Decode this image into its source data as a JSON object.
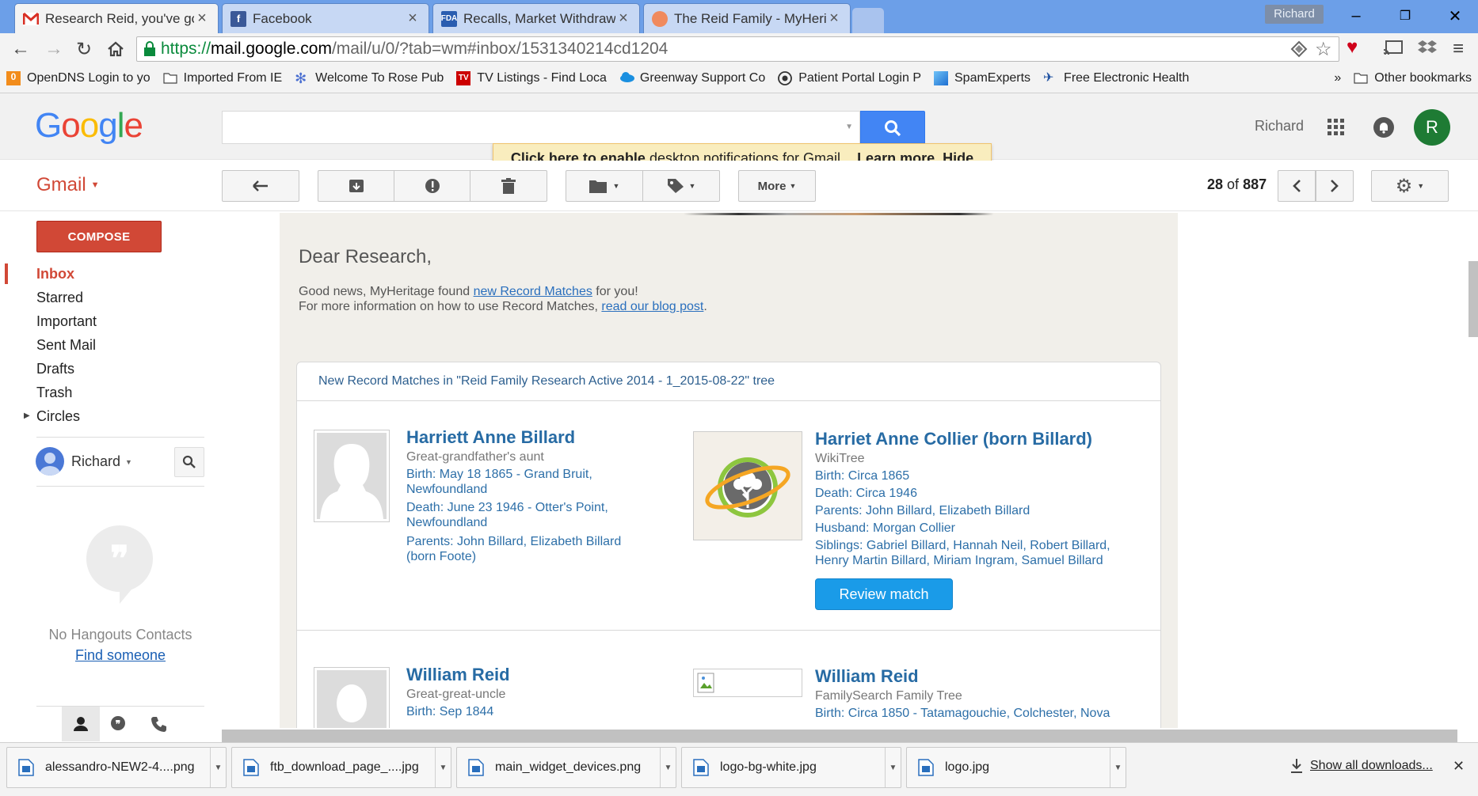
{
  "browser": {
    "tabs": [
      {
        "title": "Research Reid, you've got",
        "icon": "gmail-icon",
        "active": true
      },
      {
        "title": "Facebook",
        "icon": "facebook-icon",
        "active": false
      },
      {
        "title": "Recalls, Market Withdraw",
        "icon": "fda-icon",
        "active": false
      },
      {
        "title": "The Reid Family - MyHerit",
        "icon": "myheritage-icon",
        "active": false
      }
    ],
    "profile_name": "Richard",
    "url": "https://mail.google.com/mail/u/0/?tab=wm#inbox/1531340214cd1204",
    "url_scheme": "https://",
    "url_host": "mail.google.com",
    "url_path": "/mail/u/0/?tab=wm#inbox/1531340214cd1204",
    "bookmarks": [
      {
        "label": "OpenDNS Login to yo",
        "icon": "opendns-icon"
      },
      {
        "label": "Imported From IE",
        "icon": "folder-icon"
      },
      {
        "label": "Welcome To Rose Pub",
        "icon": "gear-blue-icon"
      },
      {
        "label": "TV Listings - Find Loca",
        "icon": "tv-icon"
      },
      {
        "label": "Greenway Support Co",
        "icon": "cloud-icon"
      },
      {
        "label": "Patient Portal Login P",
        "icon": "globe-icon"
      },
      {
        "label": "SpamExperts",
        "icon": "spam-icon"
      },
      {
        "label": "Free Electronic Health",
        "icon": "ehr-icon"
      }
    ],
    "bookmarks_overflow": "»",
    "other_bookmarks": "Other bookmarks"
  },
  "gmail": {
    "logo_letters": [
      "G",
      "o",
      "o",
      "g",
      "l",
      "e"
    ],
    "logo_colors": [
      "#4285f4",
      "#ea4335",
      "#fbbc05",
      "#4285f4",
      "#34a853",
      "#ea4335"
    ],
    "user_name": "Richard",
    "avatar_letter": "R",
    "notification": {
      "link_text": "Click here to enable",
      "text": " desktop notifications for Gmail.",
      "learn_more": "Learn more",
      "hide": "Hide"
    },
    "app_label": "Gmail",
    "more_label": "More",
    "pagination": {
      "current": "28",
      "of": "of",
      "total": "887"
    },
    "compose_label": "COMPOSE",
    "nav": [
      "Inbox",
      "Starred",
      "Important",
      "Sent Mail",
      "Drafts",
      "Trash",
      "Circles"
    ],
    "hangouts": {
      "user": "Richard",
      "empty_text": "No Hangouts Contacts",
      "find_link": "Find someone"
    }
  },
  "email": {
    "greeting": "Dear Research,",
    "line1_pre": "Good news, MyHeritage found ",
    "line1_link": "new Record Matches",
    "line1_post": " for you!",
    "line2_pre": "For more information on how to use Record Matches, ",
    "line2_link": "read our blog post",
    "line2_post": ".",
    "tree_header": "New Record Matches in \"Reid Family Research Active 2014 - 1_2015-08-22\" tree",
    "match1": {
      "left": {
        "name": "Harriett Anne Billard",
        "relation": "Great-grandfather's aunt",
        "birth": "Birth: May 18 1865 - Grand Bruit,",
        "birth2": "Newfoundland",
        "death": "Death: June 23 1946 - Otter's Point,",
        "death2": "Newfoundland",
        "parents": "Parents: John Billard, Elizabeth Billard",
        "parents2": "(born Foote)"
      },
      "right": {
        "name": "Harriet Anne Collier (born Billard)",
        "source": "WikiTree",
        "birth": "Birth: Circa 1865",
        "death": "Death: Circa 1946",
        "parents": "Parents: John Billard, Elizabeth Billard",
        "husband": "Husband: Morgan Collier",
        "siblings": "Siblings: Gabriel Billard, Hannah Neil, Robert Billard,",
        "siblings2": "Henry Martin Billard, Miriam Ingram, Samuel Billard",
        "button": "Review match"
      }
    },
    "match2": {
      "left": {
        "name": "William Reid",
        "relation": "Great-great-uncle",
        "birth": "Birth: Sep 1844"
      },
      "right": {
        "name": "William Reid",
        "source": "FamilySearch Family Tree",
        "birth": "Birth: Circa 1850 - Tatamagouchie, Colchester, Nova"
      }
    }
  },
  "downloads": {
    "items": [
      "alessandro-NEW2-4....png",
      "ftb_download_page_....jpg",
      "main_widget_devices.png",
      "logo-bg-white.jpg",
      "logo.jpg"
    ],
    "show_all": "Show all downloads..."
  }
}
